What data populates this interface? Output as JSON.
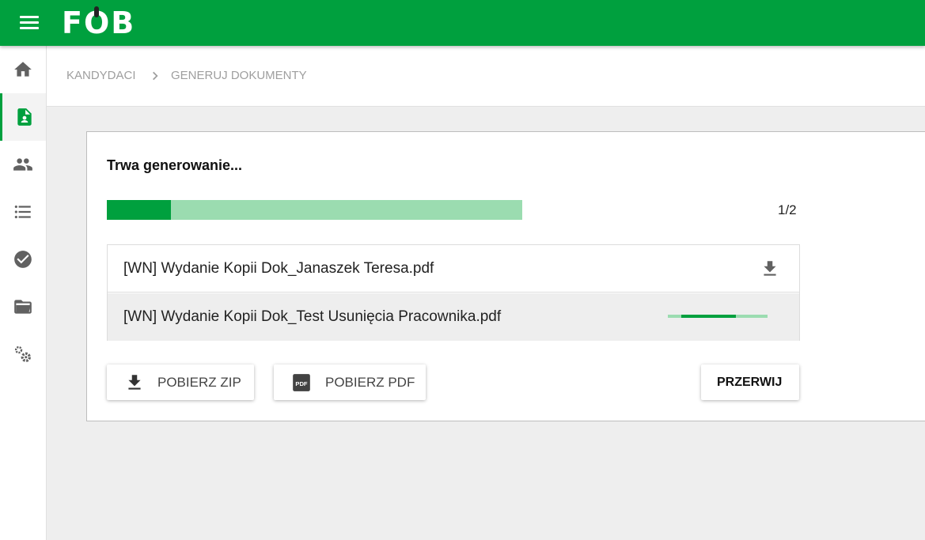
{
  "app": {
    "logo_text": "FOB",
    "brand_color": "#00a03e",
    "brand_light": "#9bdcb0"
  },
  "sidebar": {
    "items": [
      {
        "icon": "home-icon",
        "active": false
      },
      {
        "icon": "document-person-icon",
        "active": true
      },
      {
        "icon": "people-icon",
        "active": false
      },
      {
        "icon": "list-icon",
        "active": false
      },
      {
        "icon": "check-circle-icon",
        "active": false
      },
      {
        "icon": "folder-open-icon",
        "active": false
      },
      {
        "icon": "settings-gears-icon",
        "active": false
      }
    ]
  },
  "breadcrumb": {
    "items": [
      "KANDYDACI",
      "GENERUJ DOKUMENTY"
    ],
    "separator_icon": "chevron-right-icon"
  },
  "generation": {
    "title": "Trwa generowanie...",
    "progress_fraction": 0.155,
    "progress_text": "1/2",
    "files": [
      {
        "name": "[WN] Wydanie Kopii Dok_Janaszek Teresa.pdf",
        "status": "done",
        "action_icon": "download-icon"
      },
      {
        "name": "[WN] Wydanie Kopii Dok_Test Usunięcia Pracownika.pdf",
        "status": "in-progress",
        "progress_fraction": 0.55
      }
    ],
    "buttons": {
      "zip_label": "POBIERZ ZIP",
      "pdf_label": "POBIERZ PDF",
      "stop_label": "PRZERWIJ"
    }
  }
}
